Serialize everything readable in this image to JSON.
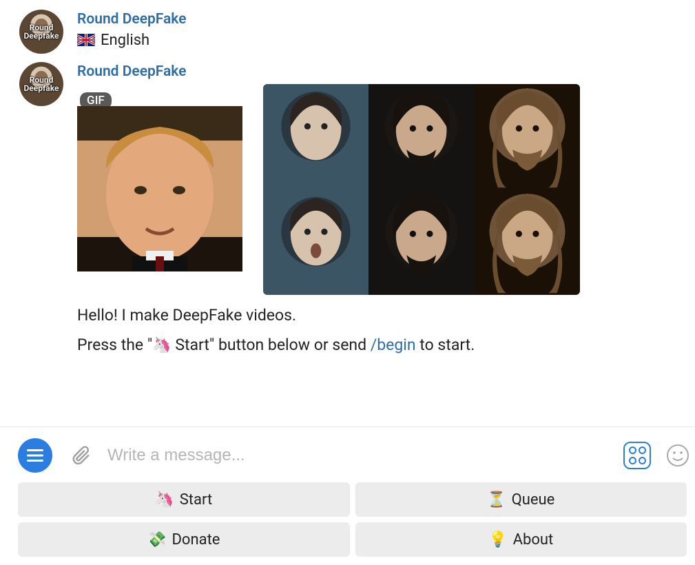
{
  "avatar_label": "Round\nDeepfake",
  "messages": [
    {
      "sender": "Round DeepFake",
      "content_type": "text_language",
      "language_label": "English"
    },
    {
      "sender": "Round DeepFake",
      "content_type": "intro",
      "gif_badge": "GIF",
      "text_lines": {
        "line1": "Hello! I make DeepFake videos.",
        "line2_prefix": "Press the \"",
        "line2_icon": "🦄",
        "line2_mid": " Start\" button below or send ",
        "line2_command": "/begin",
        "line2_suffix": " to start."
      }
    }
  ],
  "composer": {
    "placeholder": "Write a message..."
  },
  "keyboard": {
    "start": {
      "emoji": "🦄",
      "label": "Start"
    },
    "queue": {
      "emoji": "⏳",
      "label": "Queue"
    },
    "donate": {
      "emoji": "💸",
      "label": "Donate"
    },
    "about": {
      "emoji": "💡",
      "label": "About"
    }
  }
}
